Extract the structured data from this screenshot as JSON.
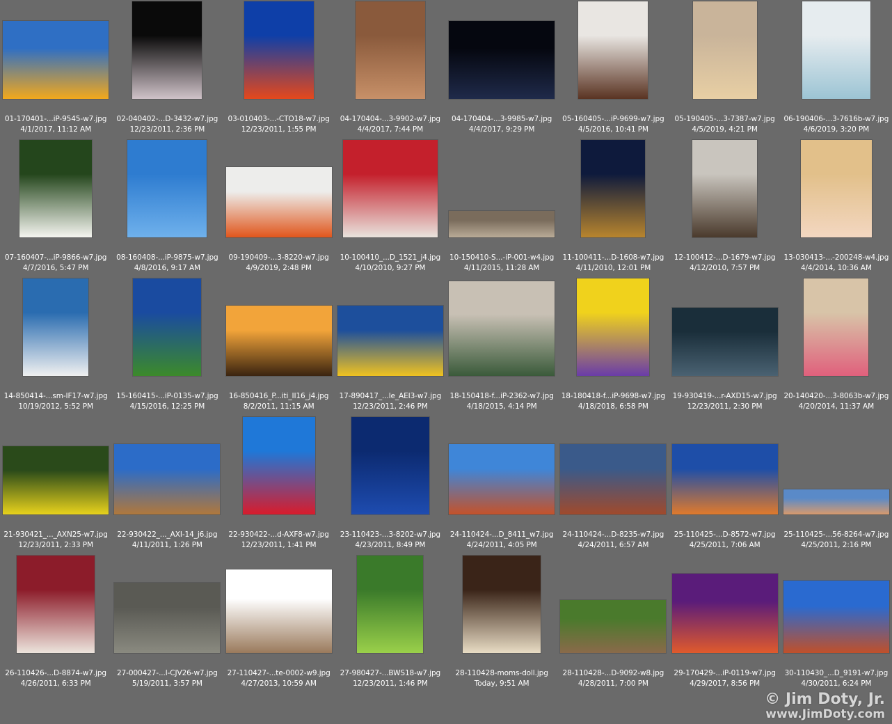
{
  "thumbnails": [
    {
      "filename": "01-170401-...iP-9545-w7.jpg",
      "date": "4/1/2017, 11:12 AM",
      "icon": "orange-poppies-photo",
      "colors": [
        "#2f6fc4",
        "#f2a81c"
      ]
    },
    {
      "filename": "02-040402-...D-3432-w7.jpg",
      "date": "12/23/2011, 2:36 PM",
      "icon": "dancer-photo",
      "colors": [
        "#0a0a0a",
        "#cfc2c8"
      ]
    },
    {
      "filename": "03-010403-...-CTO18-w7.jpg",
      "date": "12/23/2011, 1:55 PM",
      "icon": "poppies-sky-photo",
      "colors": [
        "#0e3fa8",
        "#e5481c"
      ]
    },
    {
      "filename": "04-170404-...3-9902-w7.jpg",
      "date": "4/4/2017, 7:44 PM",
      "icon": "canyon-photo",
      "colors": [
        "#8a5a3c",
        "#c79068"
      ]
    },
    {
      "filename": "04-170404-...3-9985-w7.jpg",
      "date": "4/4/2017, 9:29 PM",
      "icon": "night-sky-photo",
      "colors": [
        "#05070f",
        "#1f2a4a"
      ]
    },
    {
      "filename": "05-160405-...iP-9699-w7.jpg",
      "date": "4/5/2016, 10:41 PM",
      "icon": "chocolate-egg-photo",
      "colors": [
        "#e9e6e2",
        "#5a3322"
      ]
    },
    {
      "filename": "05-190405-...3-7387-w7.jpg",
      "date": "4/5/2019, 4:21 PM",
      "icon": "woman-portrait-photo",
      "colors": [
        "#c9b49a",
        "#e8cfa4"
      ]
    },
    {
      "filename": "06-190406-...3-7616b-w7.jpg",
      "date": "4/6/2019, 3:20 PM",
      "icon": "bride-photo",
      "colors": [
        "#e6ecef",
        "#9cc4d4"
      ]
    },
    {
      "filename": "07-160407-...iP-9866-w7.jpg",
      "date": "4/7/2016, 5:47 PM",
      "icon": "calla-lily-photo",
      "colors": [
        "#24461c",
        "#f5f5f0"
      ]
    },
    {
      "filename": "08-160408-...iP-9875-w7.jpg",
      "date": "4/8/2016, 9:17 AM",
      "icon": "raindrops-tower-photo",
      "colors": [
        "#2e7cd0",
        "#6fb1ec"
      ]
    },
    {
      "filename": "09-190409-...3-8220-w7.jpg",
      "date": "4/9/2019, 2:48 PM",
      "icon": "orange-bin-photo",
      "colors": [
        "#ededeb",
        "#e0561c"
      ]
    },
    {
      "filename": "10-100410_...D_1521_j4.jpg",
      "date": "4/10/2010, 9:27 PM",
      "icon": "girls-red-dresses-photo",
      "colors": [
        "#c4202c",
        "#e9e3dd"
      ]
    },
    {
      "filename": "10-150410-S...-iP-001-w4.jpg",
      "date": "4/11/2015, 11:28 AM",
      "icon": "gallery-panorama-photo",
      "colors": [
        "#7a6c5c",
        "#b9ab97"
      ]
    },
    {
      "filename": "11-100411-...D-1608-w7.jpg",
      "date": "4/11/2010, 12:01 PM",
      "icon": "auditorium-dome-photo",
      "colors": [
        "#0e1a3c",
        "#b8852e"
      ]
    },
    {
      "filename": "12-100412-...D-1679-w7.jpg",
      "date": "4/12/2010, 7:57 PM",
      "icon": "spiral-ceiling-photo",
      "colors": [
        "#c9c5be",
        "#4a3a2c"
      ]
    },
    {
      "filename": "13-030413-...-200248-w4.jpg",
      "date": "4/4/2014, 10:36 AM",
      "icon": "child-portrait-photo",
      "colors": [
        "#e2c08a",
        "#f3d7c1"
      ]
    },
    {
      "filename": "14-850414-...sm-IF17-w7.jpg",
      "date": "10/19/2012, 5:52 PM",
      "icon": "men-lake-photo",
      "colors": [
        "#2a6cb0",
        "#f0f0f0"
      ]
    },
    {
      "filename": "15-160415-...iP-0135-w7.jpg",
      "date": "4/15/2016, 12:25 PM",
      "icon": "dog-field-photo",
      "colors": [
        "#1a4ba0",
        "#3c8a2a"
      ]
    },
    {
      "filename": "16-850416_P...iti_II16_j4.jpg",
      "date": "8/2/2011, 11:15 AM",
      "icon": "palm-sunset-photo",
      "colors": [
        "#f2a43a",
        "#3a2410"
      ]
    },
    {
      "filename": "17-890417_...le_AEI3-w7.jpg",
      "date": "12/23/2011, 2:46 PM",
      "icon": "bald-eagle-photo",
      "colors": [
        "#1d4f9c",
        "#f0c220"
      ]
    },
    {
      "filename": "18-150418-f...iP-2362-w7.jpg",
      "date": "4/18/2015, 4:14 PM",
      "icon": "faucet-sprinkler-photo",
      "colors": [
        "#c8c0b4",
        "#3a5a3a"
      ]
    },
    {
      "filename": "18-180418-f...iP-9698-w7.jpg",
      "date": "4/18/2018, 6:58 PM",
      "icon": "pansies-photo",
      "colors": [
        "#f0d21c",
        "#6a3ca8"
      ]
    },
    {
      "filename": "19-930419-...r-AXD15-w7.jpg",
      "date": "12/23/2011, 2:30 PM",
      "icon": "alligator-photo",
      "colors": [
        "#1a2e3a",
        "#4a6272"
      ]
    },
    {
      "filename": "20-140420-...3-8063b-w7.jpg",
      "date": "4/20/2014, 11:37 AM",
      "icon": "bunny-ears-girl-photo",
      "colors": [
        "#d8c4a8",
        "#e0607c"
      ]
    },
    {
      "filename": "21-930421_..._AXN25-w7.jpg",
      "date": "12/23/2011, 2:33 PM",
      "icon": "cactus-flowers-photo",
      "colors": [
        "#2a4a1a",
        "#e8d21c"
      ]
    },
    {
      "filename": "22-930422_..._AXI-14_j6.jpg",
      "date": "4/11/2011, 1:26 PM",
      "icon": "river-canyon-photo",
      "colors": [
        "#2c6cc8",
        "#b0783c"
      ]
    },
    {
      "filename": "22-930422-...d-AXF8-w7.jpg",
      "date": "12/23/2011, 1:41 PM",
      "icon": "ocotillo-flower-photo",
      "colors": [
        "#1f78d8",
        "#d81c2c"
      ]
    },
    {
      "filename": "23-110423-...3-8202-w7.jpg",
      "date": "4/23/2011, 8:49 PM",
      "icon": "rock-silhouette-photo",
      "colors": [
        "#0c2a70",
        "#1e4cb0"
      ]
    },
    {
      "filename": "24-110424-...D_8411_w7.jpg",
      "date": "4/24/2011, 4:05 PM",
      "icon": "red-rocks-photo",
      "colors": [
        "#3f86d8",
        "#c4522a"
      ]
    },
    {
      "filename": "24-110424-...D-8235-w7.jpg",
      "date": "4/24/2011, 6:57 AM",
      "icon": "canyon-overlook-photo",
      "colors": [
        "#3a5a8a",
        "#a04a2c"
      ]
    },
    {
      "filename": "25-110425-...D-8572-w7.jpg",
      "date": "4/25/2011, 7:06 AM",
      "icon": "hoodoos-photo",
      "colors": [
        "#1e4ea8",
        "#e07a2c"
      ]
    },
    {
      "filename": "25-110425-...56-8264-w7.jpg",
      "date": "4/25/2011, 2:16 PM",
      "icon": "slickrock-panorama-photo",
      "colors": [
        "#5a8ac8",
        "#d89a6c"
      ]
    },
    {
      "filename": "26-110426-...D-8874-w7.jpg",
      "date": "4/26/2011, 6:33 PM",
      "icon": "elderly-woman-photo",
      "colors": [
        "#8c1c2a",
        "#ece4dc"
      ]
    },
    {
      "filename": "27-000427-...l-CJV26-w7.jpg",
      "date": "5/19/2011, 3:57 PM",
      "icon": "owl-photo",
      "colors": [
        "#5a5a54",
        "#8a8a80"
      ]
    },
    {
      "filename": "27-110427-...te-0002-w9.jpg",
      "date": "4/27/2013, 10:59 AM",
      "icon": "photo-collage",
      "colors": [
        "#ffffff",
        "#9a7a5c"
      ]
    },
    {
      "filename": "27-980427-...BWS18-w7.jpg",
      "date": "12/23/2011, 1:46 PM",
      "icon": "trillium-forest-photo",
      "colors": [
        "#3a7a2a",
        "#9ad04a"
      ]
    },
    {
      "filename": "28-110428-moms-doll.jpg",
      "date": "Today, 9:51 AM",
      "icon": "antique-doll-photo",
      "colors": [
        "#3a2418",
        "#e8dcc4"
      ]
    },
    {
      "filename": "28-110428-...D-9092-w8.jpg",
      "date": "4/28/2011, 7:00 PM",
      "icon": "family-grass-photo",
      "colors": [
        "#4a7a2c",
        "#8a6a4a"
      ]
    },
    {
      "filename": "29-170429-...iP-0119-w7.jpg",
      "date": "4/29/2017, 8:56 PM",
      "icon": "purple-sunset-photo",
      "colors": [
        "#5a1c7a",
        "#e05a2c"
      ]
    },
    {
      "filename": "30-110430_...D_9191-w7.jpg",
      "date": "4/30/2011, 6:24 PM",
      "icon": "balanced-rock-photo",
      "colors": [
        "#2a6ad0",
        "#c0502a"
      ]
    }
  ],
  "watermark": {
    "line1": "© Jim Doty, Jr.",
    "line2": "www.JimDoty.com"
  }
}
